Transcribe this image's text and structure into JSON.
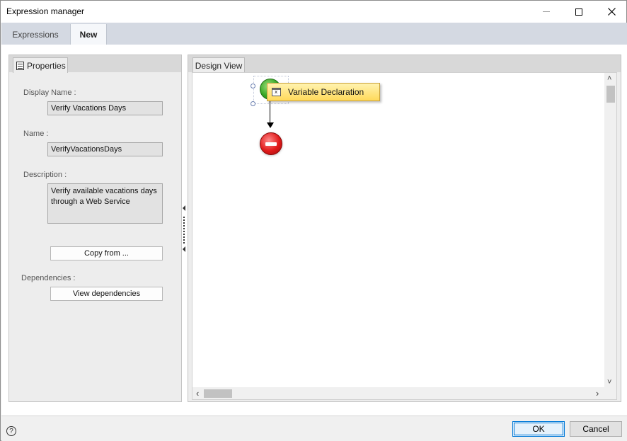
{
  "window": {
    "title": "Expression manager"
  },
  "tabs": [
    {
      "label": "Expressions"
    },
    {
      "label": "New"
    }
  ],
  "properties": {
    "tab_label": "Properties",
    "display_name_label": "Display Name :",
    "display_name_value": "Verify Vacations Days",
    "name_label": "Name :",
    "name_value": "VerifyVacationsDays",
    "description_label": "Description :",
    "description_line1": "Verify available vacations days",
    "description_line2": "through a Web Service",
    "copy_from_label": "Copy from ...",
    "dependencies_label": "Dependencies :",
    "view_dependencies_label": "View dependencies"
  },
  "design": {
    "tab_label": "Design View",
    "tooltip": "Variable Declaration"
  },
  "footer": {
    "help": "?",
    "ok_label": "OK",
    "cancel_label": "Cancel"
  },
  "scroll": {
    "up": "˄",
    "down": "˅",
    "left": "‹",
    "right": "›"
  }
}
